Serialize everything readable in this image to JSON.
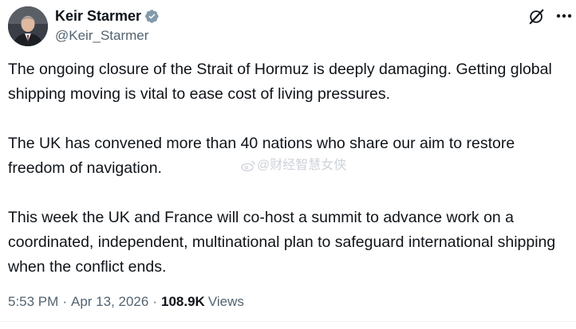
{
  "author": {
    "display_name": "Keir Starmer",
    "handle": "@Keir_Starmer",
    "verified_icon": "verified-badge-icon"
  },
  "actions": {
    "grok_icon": "grok-icon",
    "more_icon": "more-horizontal-icon"
  },
  "tweet": {
    "paragraphs": [
      "The ongoing closure of the Strait of Hormuz is deeply damaging. Getting global shipping moving is vital to ease cost of living pressures.",
      "The UK has convened more than 40 nations who share our aim to restore freedom of navigation.",
      "This week the UK and France will co-host a summit to advance work on a coordinated, independent, multinational plan to safeguard international shipping when the conflict ends."
    ]
  },
  "watermark": {
    "text": "@财经智慧女侠"
  },
  "meta": {
    "time": "5:53 PM",
    "separator": "·",
    "date": "Apr 13, 2026",
    "views_count": "108.9K",
    "views_label": "Views"
  },
  "colors": {
    "text_primary": "#0f1419",
    "text_secondary": "#536471",
    "verified_gray": "#829aab",
    "divider": "#eff3f4"
  }
}
